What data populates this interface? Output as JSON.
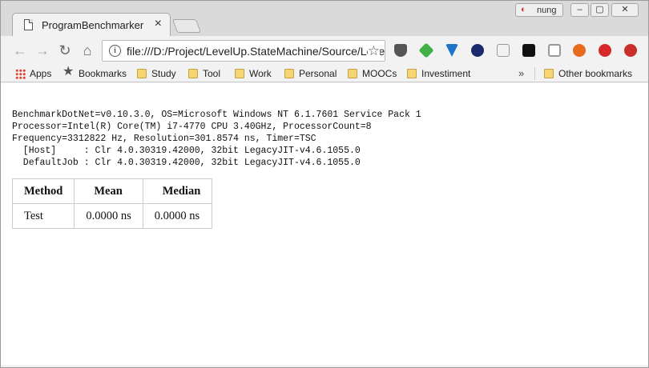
{
  "browser": {
    "tab_title": "ProgramBenchmarker",
    "tab_close": "×",
    "profile_name": "nung",
    "url": "file:///D:/Project/LevelUp.StateMachine/Source/LevelUp.StateMachine.Benchmark/BenchmarkDotNet.Artifacts/results/ProgramBenchmarker-report.html"
  },
  "bookmarks": {
    "apps": "Apps",
    "bookmarks": "Bookmarks",
    "study": "Study",
    "tool": "Tool",
    "work": "Work",
    "personal": "Personal",
    "moocs": "MOOCs",
    "investment": "Investiment",
    "overflow": "»",
    "other": "Other bookmarks"
  },
  "report": {
    "env_lines": [
      "BenchmarkDotNet=v0.10.3.0, OS=Microsoft Windows NT 6.1.7601 Service Pack 1",
      "Processor=Intel(R) Core(TM) i7-4770 CPU 3.40GHz, ProcessorCount=8",
      "Frequency=3312822 Hz, Resolution=301.8574 ns, Timer=TSC",
      "  [Host]     : Clr 4.0.30319.42000, 32bit LegacyJIT-v4.6.1055.0",
      "  DefaultJob : Clr 4.0.30319.42000, 32bit LegacyJIT-v4.6.1055.0"
    ],
    "table": {
      "headers": [
        "Method",
        "Mean",
        "Median"
      ],
      "rows": [
        [
          "Test",
          "0.0000 ns",
          "0.0000 ns"
        ]
      ]
    }
  }
}
